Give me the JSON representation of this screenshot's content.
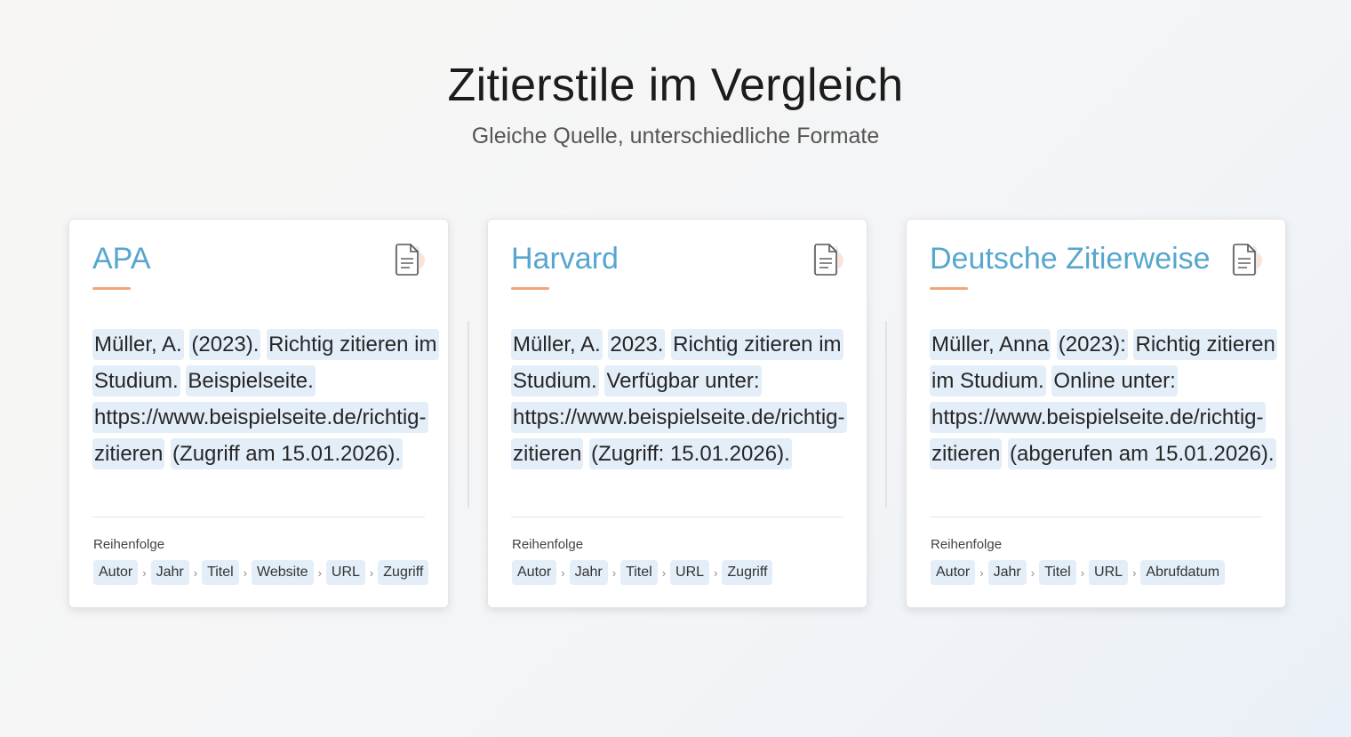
{
  "header": {
    "title": "Zitierstile im Vergleich",
    "subtitle": "Gleiche Quelle, unterschiedliche Formate"
  },
  "colors": {
    "accent_title": "#56a6cf",
    "underline": "#f0a67a",
    "highlight": "#e3eef8"
  },
  "cards": [
    {
      "title": "APA",
      "icon": "document-icon",
      "segments": [
        "Müller, A.",
        "(2023).",
        "Richtig zitieren im Studium.",
        "Beispielseite.",
        "https://www.beispielseite.de/richtig-zitieren",
        "(Zugriff am 15.01.2026)."
      ],
      "order_label": "Reihenfolge",
      "order": [
        "Autor",
        "Jahr",
        "Titel",
        "Website",
        "URL",
        "Zugriff"
      ]
    },
    {
      "title": "Harvard",
      "icon": "document-icon",
      "segments": [
        "Müller, A.",
        "2023.",
        "Richtig zitieren im Studium.",
        "Verfügbar unter:",
        "https://www.beispielseite.de/richtig-zitieren",
        "(Zugriff: 15.01.2026)."
      ],
      "order_label": "Reihenfolge",
      "order": [
        "Autor",
        "Jahr",
        "Titel",
        "URL",
        "Zugriff"
      ]
    },
    {
      "title": "Deutsche Zitierweise",
      "icon": "document-icon",
      "segments": [
        "Müller, Anna",
        "(2023):",
        "Richtig zitieren im Studium.",
        "Online unter:",
        "https://www.beispielseite.de/richtig-zitieren",
        "(abgerufen am 15.01.2026)."
      ],
      "order_label": "Reihenfolge",
      "order": [
        "Autor",
        "Jahr",
        "Titel",
        "URL",
        "Abrufdatum"
      ]
    }
  ]
}
